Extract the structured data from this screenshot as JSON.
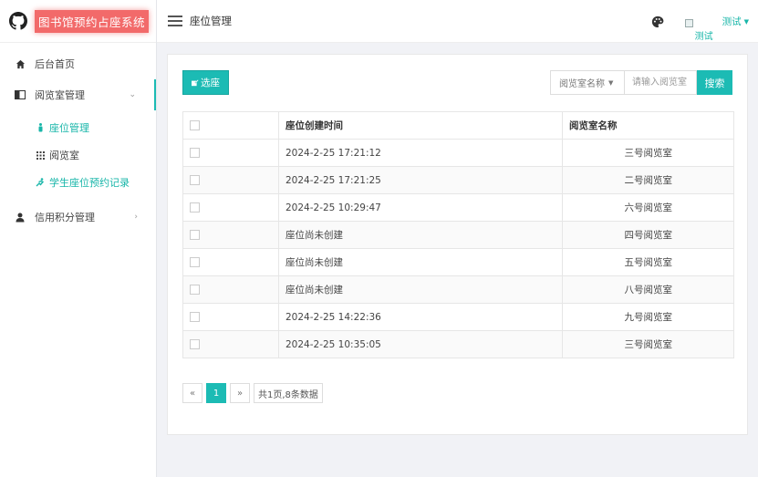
{
  "brand": {
    "title": "图书馆预约占座系统"
  },
  "sidebar": {
    "items": [
      {
        "label": "后台首页"
      },
      {
        "label": "阅览室管理"
      },
      {
        "label": "信用积分管理"
      }
    ],
    "submenu": [
      {
        "label": "座位管理"
      },
      {
        "label": "阅览室"
      },
      {
        "label": "学生座位预约记录"
      }
    ]
  },
  "header": {
    "title": "座位管理",
    "avatar_alt": "测试",
    "username": "测试"
  },
  "toolbar": {
    "select_button": "选座",
    "filter_select": "阅览室名称",
    "search_placeholder": "请输入阅览室",
    "search_button": "搜索"
  },
  "table": {
    "columns": [
      "座位创建时间",
      "阅览室名称"
    ],
    "rows": [
      {
        "time": "2024-2-25 17:21:12",
        "room": "三号阅览室"
      },
      {
        "time": "2024-2-25 17:21:25",
        "room": "二号阅览室"
      },
      {
        "time": "2024-2-25 10:29:47",
        "room": "六号阅览室"
      },
      {
        "time": "座位尚未创建",
        "room": "四号阅览室"
      },
      {
        "time": "座位尚未创建",
        "room": "五号阅览室"
      },
      {
        "time": "座位尚未创建",
        "room": "八号阅览室"
      },
      {
        "time": "2024-2-25 14:22:36",
        "room": "九号阅览室"
      },
      {
        "time": "2024-2-25 10:35:05",
        "room": "三号阅览室"
      }
    ]
  },
  "pagination": {
    "prev": "«",
    "current": "1",
    "next": "»",
    "info": "共1页,8条数据"
  },
  "colors": {
    "accent": "#1cbbb4",
    "brand_bg": "#f26a6a"
  }
}
